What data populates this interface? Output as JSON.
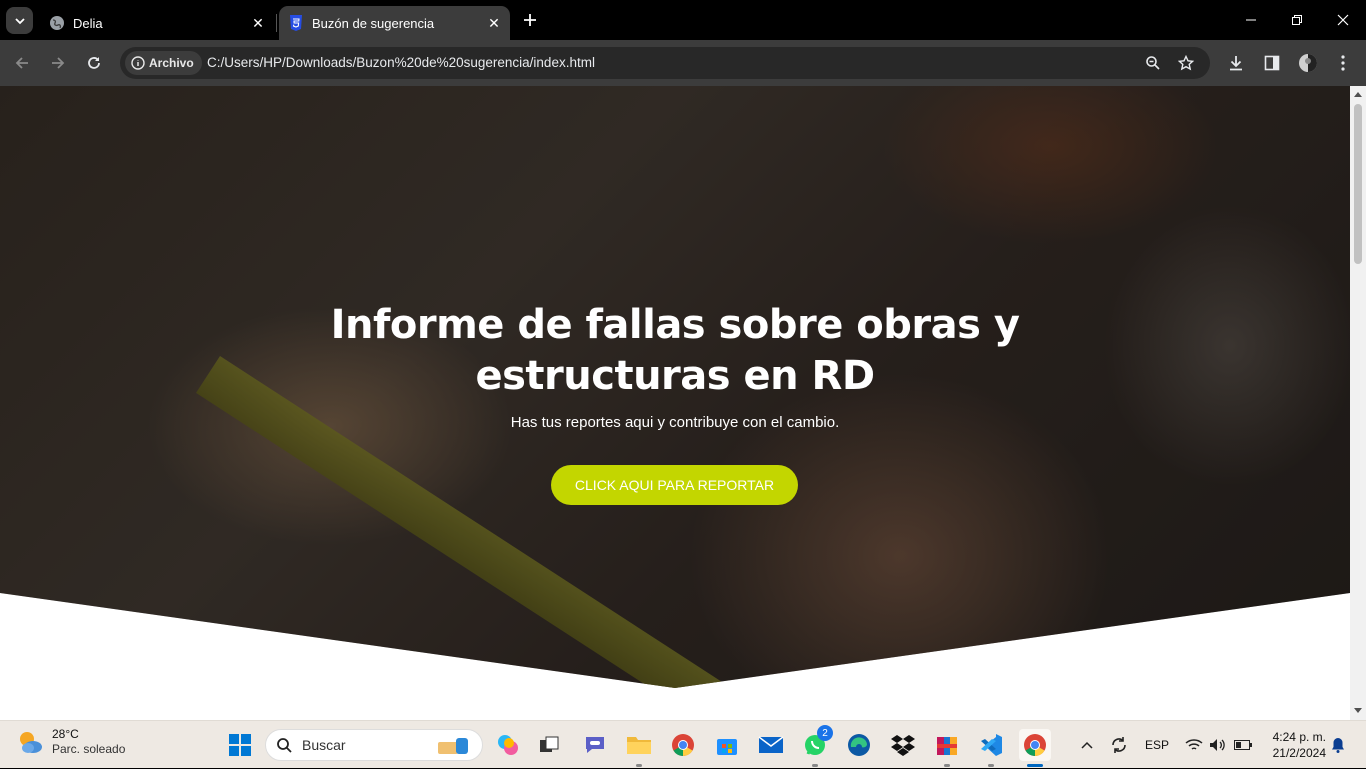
{
  "browser": {
    "tabs": [
      {
        "title": "Delia",
        "active": false,
        "icon": "globe-icon"
      },
      {
        "title": "Buzón de sugerencia",
        "active": true,
        "icon": "css-file-icon"
      }
    ],
    "address": {
      "chip_label": "Archivo",
      "url": "C:/Users/HP/Downloads/Buzon%20de%20sugerencia/index.html"
    }
  },
  "page": {
    "hero": {
      "title_line1": "Informe de fallas sobre obras y",
      "title_line2": "estructuras en RD",
      "subtitle": "Has tus reportes aqui y contribuye con el cambio.",
      "cta_label": "CLICK AQUI PARA REPORTAR"
    },
    "colors": {
      "accent": "#c3d600",
      "text": "#ffffff"
    }
  },
  "taskbar": {
    "weather": {
      "temp": "28°C",
      "condition": "Parc. soleado"
    },
    "search_placeholder": "Buscar",
    "whatsapp_badge": "2",
    "language": "ESP",
    "time": "4:24 p. m.",
    "date": "21/2/2024"
  }
}
